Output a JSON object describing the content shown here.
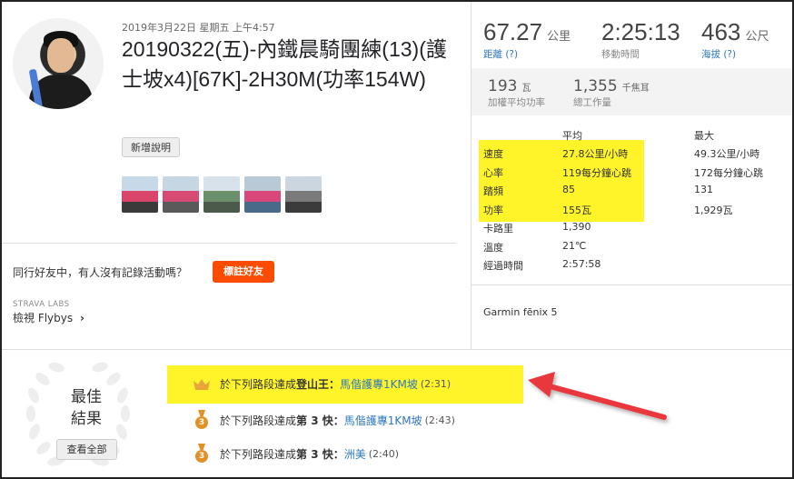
{
  "activity": {
    "date": "2019年3月22日 星期五 上午4:57",
    "title": "20190322(五)-內鐵晨騎團練(13)(護士坡x4)[67K]-2H30M(功率154W)",
    "add_description_label": "新增說明",
    "photos": [
      {
        "colors": [
          "#c7d8e8",
          "#d9456b",
          "#3a3a3a"
        ]
      },
      {
        "colors": [
          "#c6d6e2",
          "#d64a74",
          "#5a5a5a"
        ]
      },
      {
        "colors": [
          "#d8e2ea",
          "#6b8f6a",
          "#4b5a4b"
        ]
      },
      {
        "colors": [
          "#b9c9d6",
          "#d8467a",
          "#4a6a8a"
        ]
      },
      {
        "colors": [
          "#cbd6df",
          "#7a7a7a",
          "#3b3b3b"
        ]
      }
    ]
  },
  "flyby": {
    "question": "同行好友中，有人沒有記錄活動嗎？",
    "tag_button_label": "標註好友",
    "labs_label": "STRAVA LABS",
    "flybys_link_label": "檢視 Flybys"
  },
  "primary_stats": [
    {
      "value": "67.27",
      "unit": "公里",
      "label": "距離 (?)",
      "link": true
    },
    {
      "value": "2:25:13",
      "unit": "",
      "label": "移動時間",
      "link": false
    },
    {
      "value": "463",
      "unit": "公尺",
      "label": "海拔 (?)",
      "link": true
    }
  ],
  "secondary_stats": [
    {
      "value": "193",
      "unit": "瓦",
      "label": "加權平均功率"
    },
    {
      "value": "1,355",
      "unit": "千焦耳",
      "label": "總工作量"
    }
  ],
  "stats_table": {
    "header_avg": "平均",
    "header_max": "最大",
    "rows": [
      {
        "name": "速度",
        "avg": "27.8公里/小時",
        "max": "49.3公里/小時"
      },
      {
        "name": "心率",
        "avg": "119每分鐘心跳",
        "max": "172每分鐘心跳"
      },
      {
        "name": "踏頻",
        "avg": "85",
        "max": "131"
      },
      {
        "name": "功率",
        "avg": "155瓦",
        "max": "1,929瓦"
      },
      {
        "name": "卡路里",
        "avg": "1,390",
        "max": ""
      },
      {
        "name": "溫度",
        "avg": "21℃",
        "max": ""
      },
      {
        "name": "經過時間",
        "avg": "2:57:58",
        "max": ""
      }
    ]
  },
  "device": "Garmin fēnix 5",
  "best_results": {
    "title_line1": "最佳",
    "title_line2": "結果",
    "view_all_label": "查看全部",
    "achievements": [
      {
        "icon": "crown-icon",
        "prefix": "於下列路段達成 ",
        "rank": "登山王：",
        "segment": "馬偕護專1KM坡",
        "time": "(2:31)"
      },
      {
        "icon": "medal-3-icon",
        "prefix": "於下列路段達成 ",
        "rank": "第 3 快：",
        "segment": "馬偕護專1KM坡",
        "time": "(2:43)"
      },
      {
        "icon": "medal-3-icon",
        "prefix": "於下列路段達成 ",
        "rank": "第 3 快：",
        "segment": "洲美",
        "time": "(2:40)"
      }
    ],
    "medal_number": "3"
  },
  "colors": {
    "highlight": "#fff42a",
    "accent": "#fc4c02",
    "link": "#2d78be",
    "arrow": "#e8373c",
    "medal": "#e39126",
    "crown": "#e8a53a"
  }
}
